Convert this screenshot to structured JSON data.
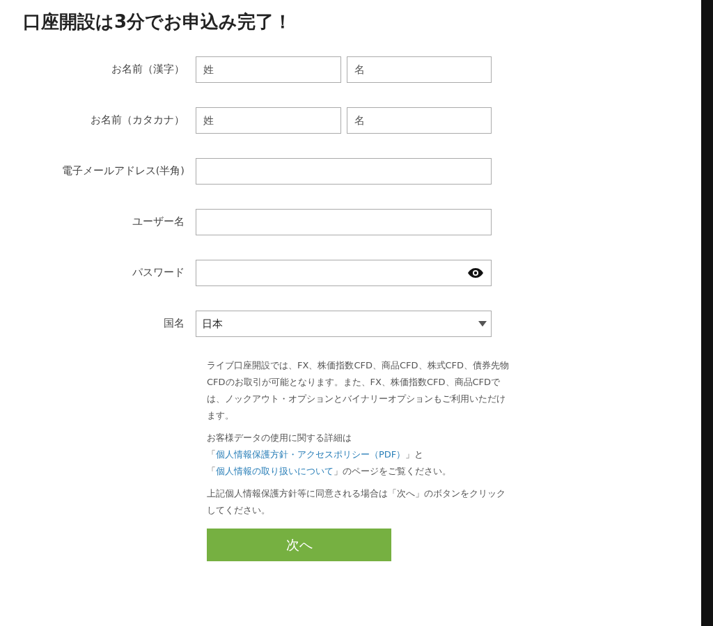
{
  "title": "口座開設は3分でお申込み完了！",
  "fields": [
    {
      "kind": "split",
      "label": "お名前（漢字）",
      "inputs": [
        {
          "placeholder": "姓"
        },
        {
          "placeholder": "名"
        }
      ]
    },
    {
      "kind": "split",
      "label": "お名前（カタカナ）",
      "inputs": [
        {
          "placeholder": "姓"
        },
        {
          "placeholder": "名"
        }
      ]
    },
    {
      "kind": "text",
      "label": "電子メールアドレス(半角)"
    },
    {
      "kind": "text",
      "label": "ユーザー名"
    },
    {
      "kind": "password",
      "label": "パスワード"
    },
    {
      "kind": "select",
      "label": "国名",
      "value": "日本"
    }
  ],
  "paragraphs": [
    [
      {
        "text": "ライブ口座開設では、FX、株価指数CFD、商品CFD、株式CFD、債券先物CFDのお取引が可能となります。また、FX、株価指数CFD、商品CFDでは、ノックアウト・オプションとバイナリーオプションもご利用いただけます。",
        "link": false
      }
    ],
    [
      {
        "text": "お客様データの使用に関する詳細は「",
        "link": false
      },
      {
        "text": "個人情報保護方針・アクセスポリシー（PDF）",
        "link": true
      },
      {
        "text": "」と「",
        "link": false
      },
      {
        "text": "個人情報の取り扱いについて",
        "link": true
      },
      {
        "text": "」のページをご覧ください。",
        "link": false
      }
    ],
    [
      {
        "text": "上記個人情報保護方針等に同意される場合は「次へ」のボタンをクリックしてください。",
        "link": false
      }
    ]
  ],
  "submit": "次へ"
}
